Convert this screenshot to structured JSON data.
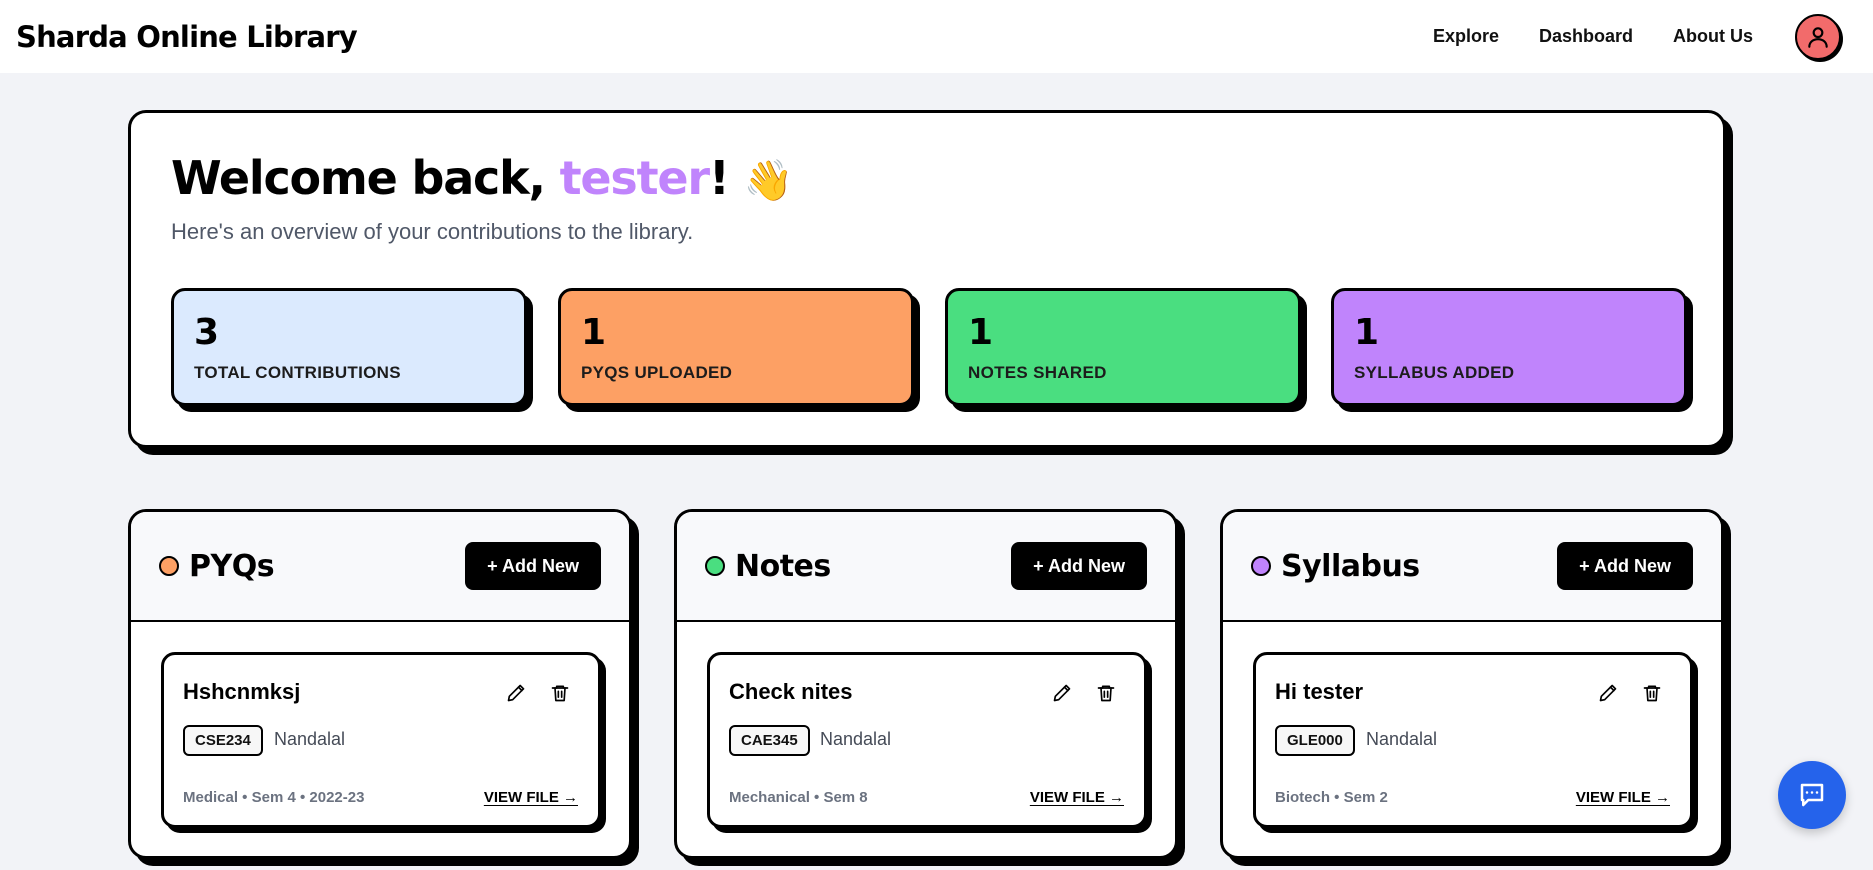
{
  "nav": {
    "brand": "Sharda Online Library",
    "links": [
      "Explore",
      "Dashboard",
      "About Us"
    ]
  },
  "welcome": {
    "greeting": "Welcome back, ",
    "username": "tester",
    "exclaim": "!",
    "emoji": "👋",
    "subtitle": "Here's an overview of your contributions to the library."
  },
  "stats": [
    {
      "value": "3",
      "label": "TOTAL CONTRIBUTIONS",
      "color": "#dbeafe"
    },
    {
      "value": "1",
      "label": "PYQS UPLOADED",
      "color": "#fda064"
    },
    {
      "value": "1",
      "label": "NOTES SHARED",
      "color": "#4ade80"
    },
    {
      "value": "1",
      "label": "SYLLABUS ADDED",
      "color": "#c084fc"
    }
  ],
  "panels": [
    {
      "title": "PYQs",
      "dot_color": "#fda064",
      "add_label": "+ Add New",
      "card": {
        "title": "Hshcnmksj",
        "code": "CSE234",
        "author": "Nandalal",
        "meta": "Medical • Sem 4 • 2022-23",
        "view_label": "VIEW FILE →"
      }
    },
    {
      "title": "Notes",
      "dot_color": "#4ade80",
      "add_label": "+ Add New",
      "card": {
        "title": "Check nites",
        "code": "CAE345",
        "author": "Nandalal",
        "meta": "Mechanical • Sem 8",
        "view_label": "VIEW FILE →"
      }
    },
    {
      "title": "Syllabus",
      "dot_color": "#c084fc",
      "add_label": "+ Add New",
      "card": {
        "title": "Hi tester",
        "code": "GLE000",
        "author": "Nandalal",
        "meta": "Biotech • Sem 2",
        "view_label": "VIEW FILE →"
      }
    }
  ],
  "icons": {
    "avatar": "user-icon",
    "edit": "pencil-icon",
    "delete": "trash-icon",
    "chat": "chat-icon"
  },
  "colors": {
    "accent_user": "#c084fc",
    "avatar_bg": "#f26b6b",
    "chat_fab": "#2563eb"
  }
}
